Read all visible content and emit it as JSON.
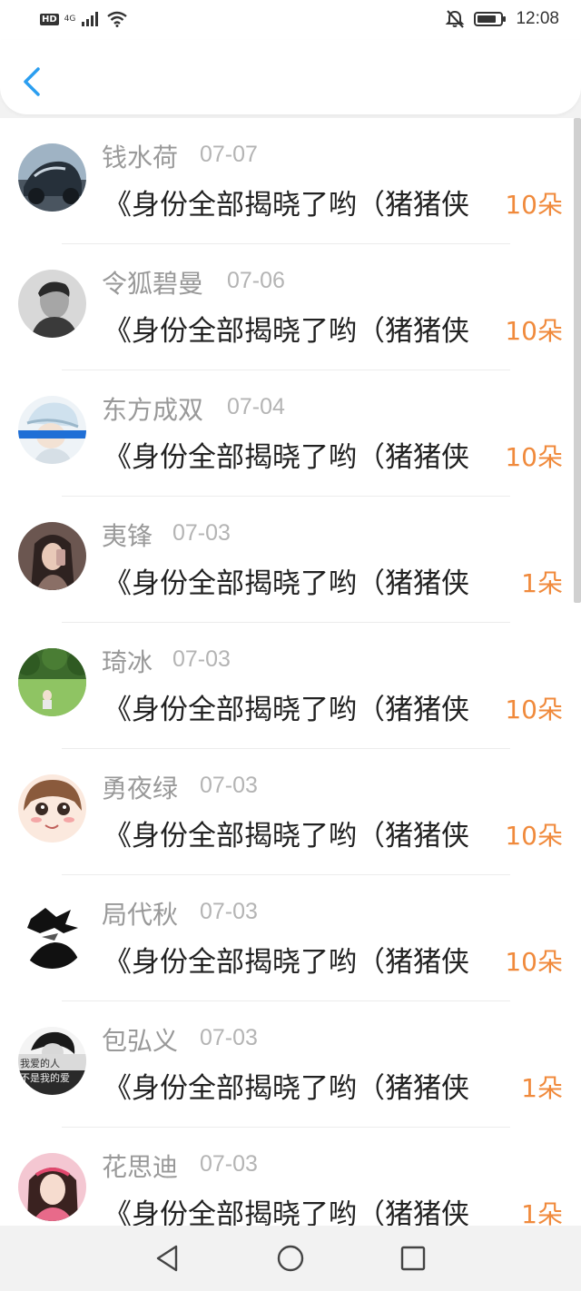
{
  "status_bar": {
    "hd": "HD",
    "net_gen": "4G",
    "time": "12:08"
  },
  "header": {
    "back_icon": "chevron-left-icon"
  },
  "gifts": [
    {
      "name": "钱水荷",
      "date": "07-07",
      "title": "《身份全部揭晓了哟（猪猪侠",
      "amount": "10朵",
      "avatar": "car-avatar"
    },
    {
      "name": "令狐碧曼",
      "date": "07-06",
      "title": "《身份全部揭晓了哟（猪猪侠",
      "amount": "10朵",
      "avatar": "portrait-bw-avatar"
    },
    {
      "name": "东方成双",
      "date": "07-04",
      "title": "《身份全部揭晓了哟（猪猪侠",
      "amount": "10朵",
      "avatar": "cap-girl-avatar"
    },
    {
      "name": "夷锋",
      "date": "07-03",
      "title": "《身份全部揭晓了哟（猪猪侠",
      "amount": "1朵",
      "avatar": "selfie-avatar"
    },
    {
      "name": "琦冰",
      "date": "07-03",
      "title": "《身份全部揭晓了哟（猪猪侠",
      "amount": "10朵",
      "avatar": "park-avatar"
    },
    {
      "name": "勇夜绿",
      "date": "07-03",
      "title": "《身份全部揭晓了哟（猪猪侠",
      "amount": "10朵",
      "avatar": "anime-girl-avatar"
    },
    {
      "name": "局代秋",
      "date": "07-03",
      "title": "《身份全部揭晓了哟（猪猪侠",
      "amount": "10朵",
      "avatar": "anime-boy-avatar"
    },
    {
      "name": "包弘义",
      "date": "07-03",
      "title": "《身份全部揭晓了哟（猪猪侠",
      "amount": "1朵",
      "avatar": "text-avatar",
      "avatar_text": [
        "我爱的人",
        "不是我的爱"
      ]
    },
    {
      "name": "花思迪",
      "date": "07-03",
      "title": "《身份全部揭晓了哟（猪猪侠",
      "amount": "1朵",
      "avatar": "pink-girl-avatar"
    }
  ],
  "nav": {
    "back": "triangle-back-icon",
    "home": "circle-home-icon",
    "recents": "square-recents-icon"
  },
  "colors": {
    "accent_blue": "#2b9ef0",
    "amount_orange": "#f08a3c",
    "name_gray": "#999999"
  }
}
